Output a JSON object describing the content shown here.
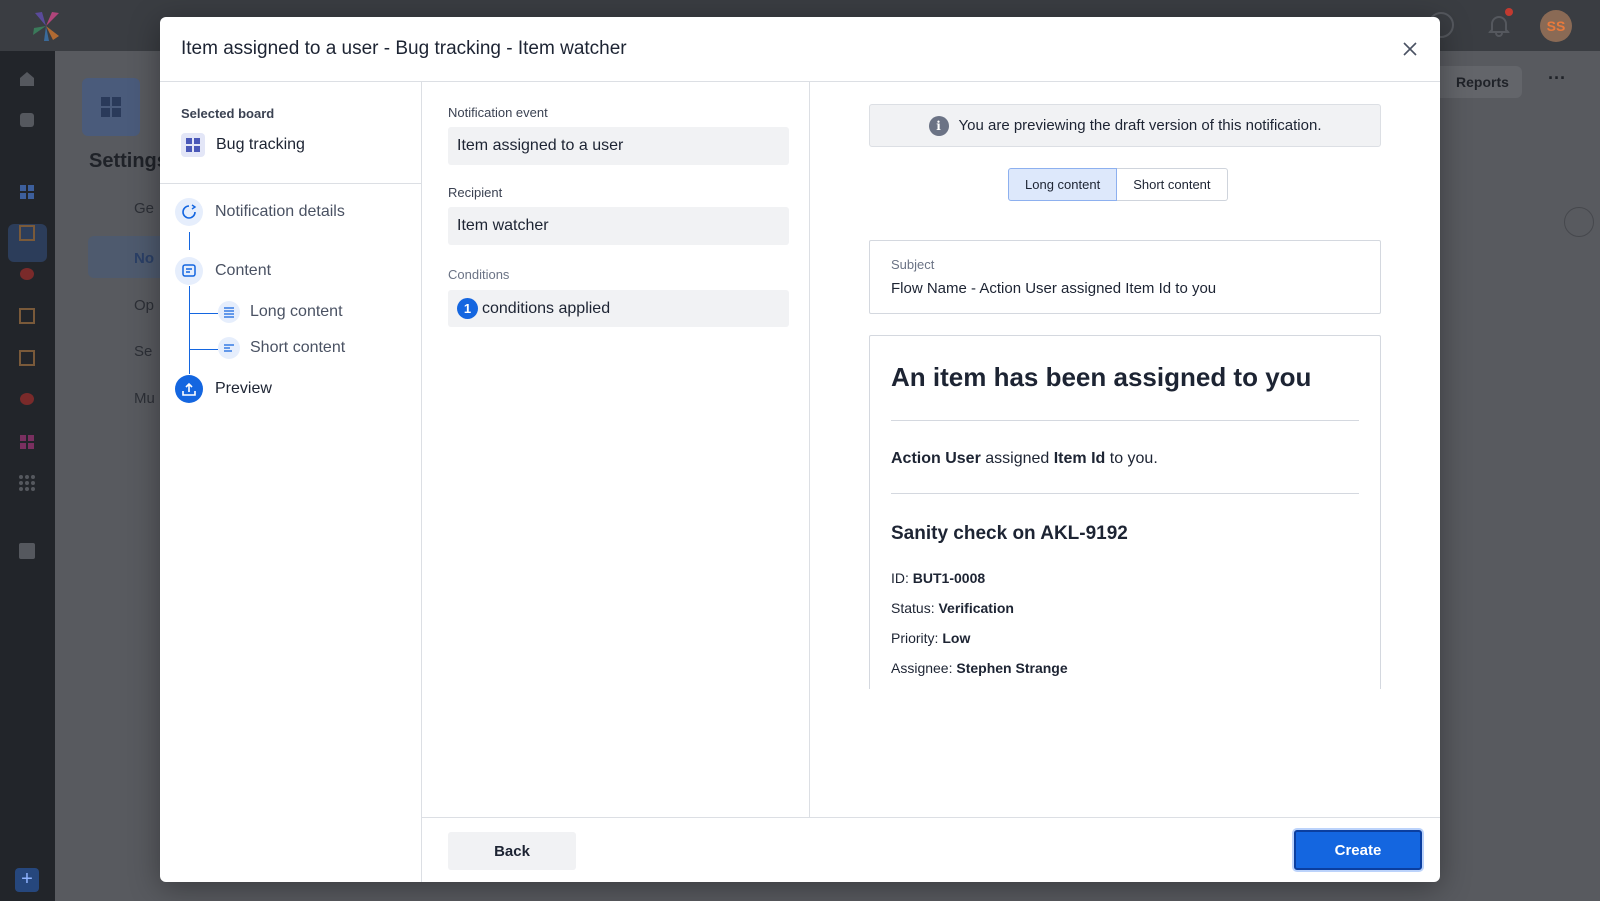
{
  "modal": {
    "title": "Item assigned to a user - Bug tracking - Item watcher",
    "close_icon": "close-icon"
  },
  "steps": {
    "selected_board_label": "Selected board",
    "board_name": "Bug tracking",
    "items": [
      {
        "label": "Notification details",
        "icon": "notification-refresh-icon",
        "active": false
      },
      {
        "label": "Content",
        "icon": "content-icon",
        "active": false
      },
      {
        "label": "Long content",
        "icon": "long-content-icon",
        "active": false
      },
      {
        "label": "Short content",
        "icon": "short-content-icon",
        "active": false
      },
      {
        "label": "Preview",
        "icon": "upload-icon",
        "active": true
      }
    ]
  },
  "details": {
    "event_label": "Notification event",
    "event_value": "Item assigned to a user",
    "recipient_label": "Recipient",
    "recipient_value": "Item watcher",
    "conditions_label": "Conditions",
    "conditions_count": "1",
    "conditions_text": "conditions applied"
  },
  "preview": {
    "banner": "You are previewing the draft version of this notification.",
    "tabs": [
      {
        "label": "Long content",
        "selected": true
      },
      {
        "label": "Short content",
        "selected": false
      }
    ],
    "subject_label": "Subject",
    "subject_text": "Flow Name - Action User assigned Item Id to you",
    "heading": "An item has been assigned to you",
    "line": {
      "actor": "Action User",
      "verb": " assigned ",
      "item": "Item Id",
      "tail": " to you."
    },
    "item_title": "Sanity check on AKL-9192",
    "meta": [
      {
        "key": "ID: ",
        "value": "BUT1-0008"
      },
      {
        "key": "Status: ",
        "value": "Verification"
      },
      {
        "key": "Priority: ",
        "value": "Low"
      },
      {
        "key": "Assignee: ",
        "value": "Stephen Strange"
      }
    ]
  },
  "footer": {
    "back_label": "Back",
    "create_label": "Create"
  },
  "background": {
    "settings_title": "Settings",
    "reports_label": "Reports",
    "avatar_initials": "SS",
    "nav_items": [
      "Ge",
      "No",
      "Op",
      "Se",
      "Mu"
    ]
  },
  "colors": {
    "primary": "#1466e0",
    "overlay": "#5d5f64",
    "sidebar": "#22252a"
  }
}
